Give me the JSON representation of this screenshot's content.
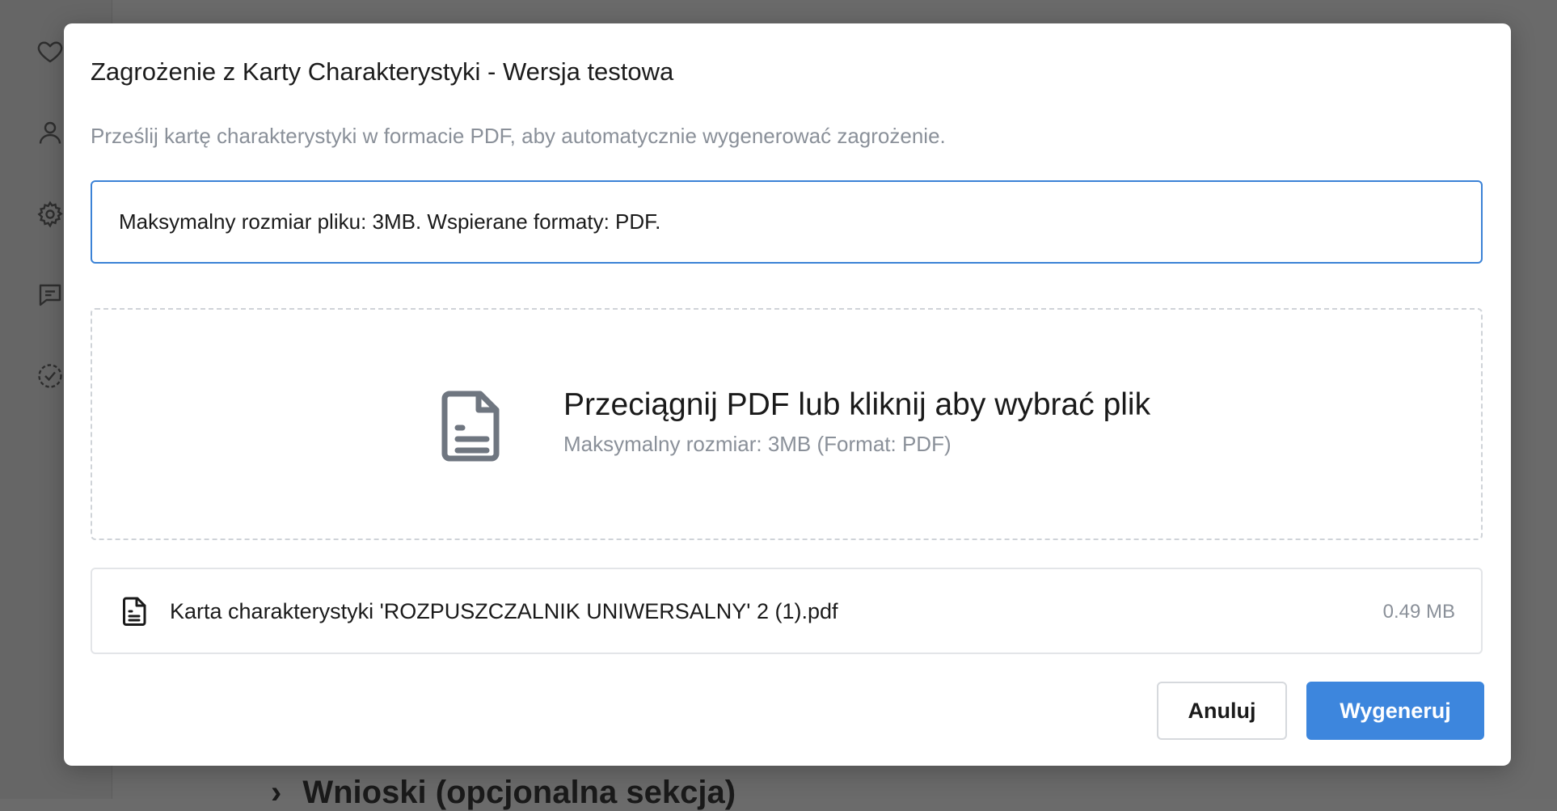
{
  "background": {
    "sidebar_icons": [
      "heart-icon",
      "user-icon",
      "gear-icon",
      "chat-icon",
      "check-circle-icon"
    ],
    "section_heading": "Wnioski (opcjonalna sekcja)"
  },
  "modal": {
    "title": "Zagrożenie z Karty Charakterystyki - Wersja testowa",
    "description": "Prześlij kartę charakterystyki w formacie PDF, aby automatycznie wygenerować zagrożenie.",
    "info": "Maksymalny rozmiar pliku: 3MB. Wspierane formaty: PDF.",
    "dropzone": {
      "icon": "document-icon",
      "title": "Przeciągnij PDF lub kliknij aby wybrać plik",
      "subtitle": "Maksymalny rozmiar: 3MB (Format: PDF)"
    },
    "file": {
      "icon": "document-icon",
      "name": "Karta charakterystyki 'ROZPUSZCZALNIK UNIWERSALNY' 2 (1).pdf",
      "size": "0.49 MB"
    },
    "buttons": {
      "cancel": "Anuluj",
      "generate": "Wygeneruj"
    }
  },
  "colors": {
    "accent": "#3d86dd",
    "info_border": "#3b82d6",
    "muted_text": "#8a9099",
    "overlay": "#6a6a6a"
  }
}
